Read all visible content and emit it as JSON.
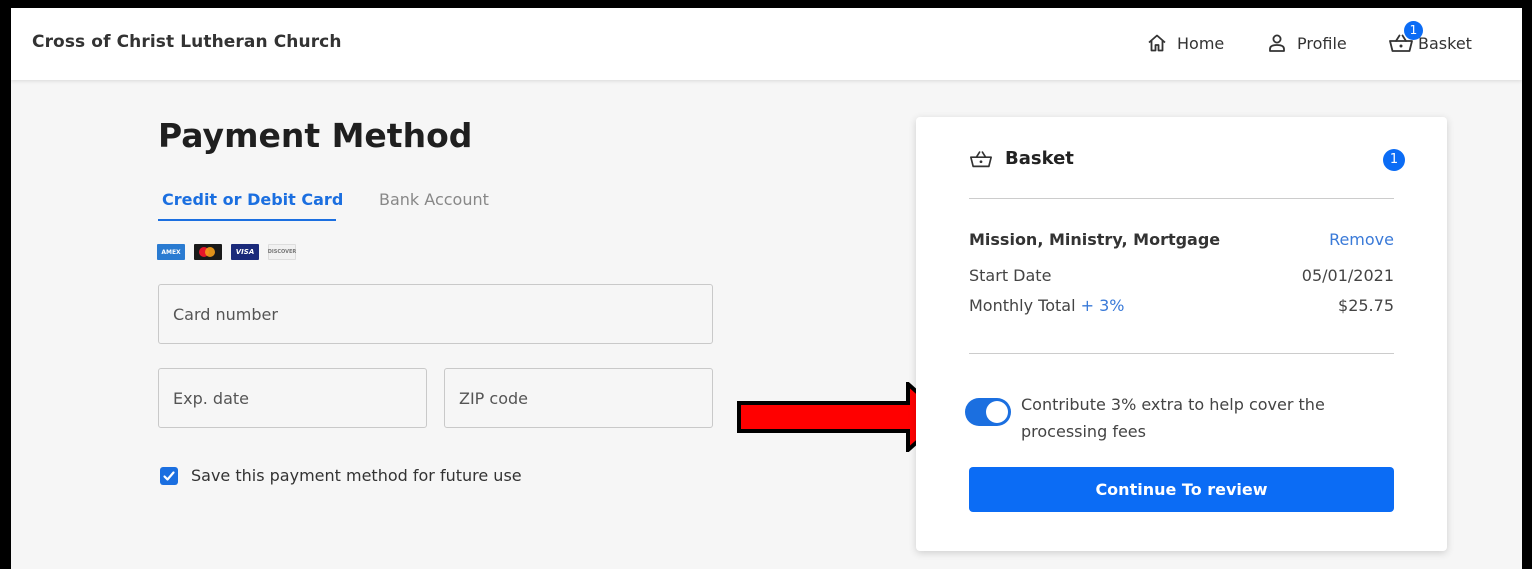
{
  "header": {
    "church_name": "Cross of Christ Lutheran Church",
    "nav": {
      "home": "Home",
      "profile": "Profile",
      "basket": "Basket",
      "basket_count": "1"
    }
  },
  "payment": {
    "title": "Payment Method",
    "tabs": {
      "card": "Credit or Debit Card",
      "bank": "Bank Account",
      "active": "card"
    },
    "card_brands": [
      "amex-icon",
      "mastercard-icon",
      "visa-icon",
      "discover-icon"
    ],
    "fields": {
      "card_number_placeholder": "Card number",
      "exp_date_placeholder": "Exp. date",
      "zip_placeholder": "ZIP code"
    },
    "save_method": {
      "label": "Save this payment method for future use",
      "checked": true
    }
  },
  "basket": {
    "title": "Basket",
    "count": "1",
    "item": {
      "name": "Mission, Ministry, Mortgage",
      "remove_label": "Remove",
      "start_date_label": "Start Date",
      "start_date_value": "05/01/2021",
      "monthly_total_label": "Monthly Total",
      "fee_label": "+ 3%",
      "monthly_total_value": "$25.75"
    },
    "contribute": {
      "text": "Contribute 3% extra to help cover the processing fees",
      "enabled": true
    },
    "cta_label": "Continue To review"
  },
  "colors": {
    "accent": "#0b6cf5",
    "link": "#3a7ad8",
    "annotation_arrow": "#ff0000"
  }
}
